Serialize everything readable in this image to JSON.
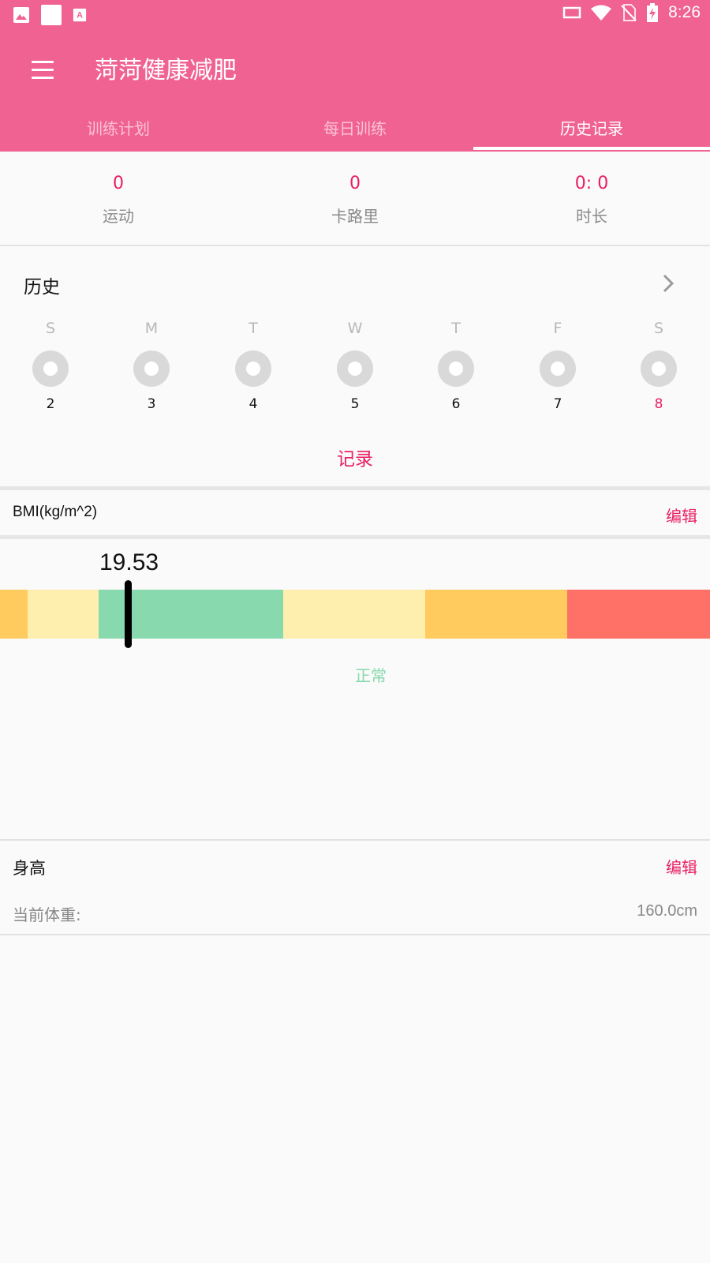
{
  "status_bar": {
    "time": "8:26",
    "left_icons": [
      "image-icon",
      "square-icon",
      "a-box-icon"
    ],
    "right_icons": [
      "cast-icon",
      "wifi-icon",
      "no-sim-icon",
      "battery-charging-icon"
    ]
  },
  "app_bar": {
    "title": "菏菏健康减肥",
    "menu_icon": "menu-icon",
    "color": "#f06292"
  },
  "tabs": [
    {
      "label": "训练计划",
      "active": false
    },
    {
      "label": "每日训练",
      "active": false
    },
    {
      "label": "历史记录",
      "active": true
    }
  ],
  "stats": [
    {
      "value": "0",
      "label": "运动"
    },
    {
      "value": "0",
      "label": "卡路里"
    },
    {
      "value": "0: 0",
      "label": "时长"
    }
  ],
  "history": {
    "title": "历史",
    "chevron_icon": "chevron-right-icon",
    "days": [
      {
        "letter": "S",
        "date": "2",
        "today": false
      },
      {
        "letter": "M",
        "date": "3",
        "today": false
      },
      {
        "letter": "T",
        "date": "4",
        "today": false
      },
      {
        "letter": "W",
        "date": "5",
        "today": false
      },
      {
        "letter": "T",
        "date": "6",
        "today": false
      },
      {
        "letter": "F",
        "date": "7",
        "today": false
      },
      {
        "letter": "S",
        "date": "8",
        "today": true
      }
    ],
    "record_link": "记录"
  },
  "bmi": {
    "label": "BMI(kg/m^2)",
    "edit_label": "编辑",
    "value": "19.53",
    "category": "正常",
    "scale_colors": [
      "#ffcb5f",
      "#ffefae",
      "#88d9ad",
      "#ffefae",
      "#ffcb5f",
      "#ff7066"
    ]
  },
  "height": {
    "title": "身高",
    "edit_label": "编辑",
    "current_label": "当前体重:",
    "current_value": "160.0cm"
  },
  "accent_color": "#e91e63"
}
